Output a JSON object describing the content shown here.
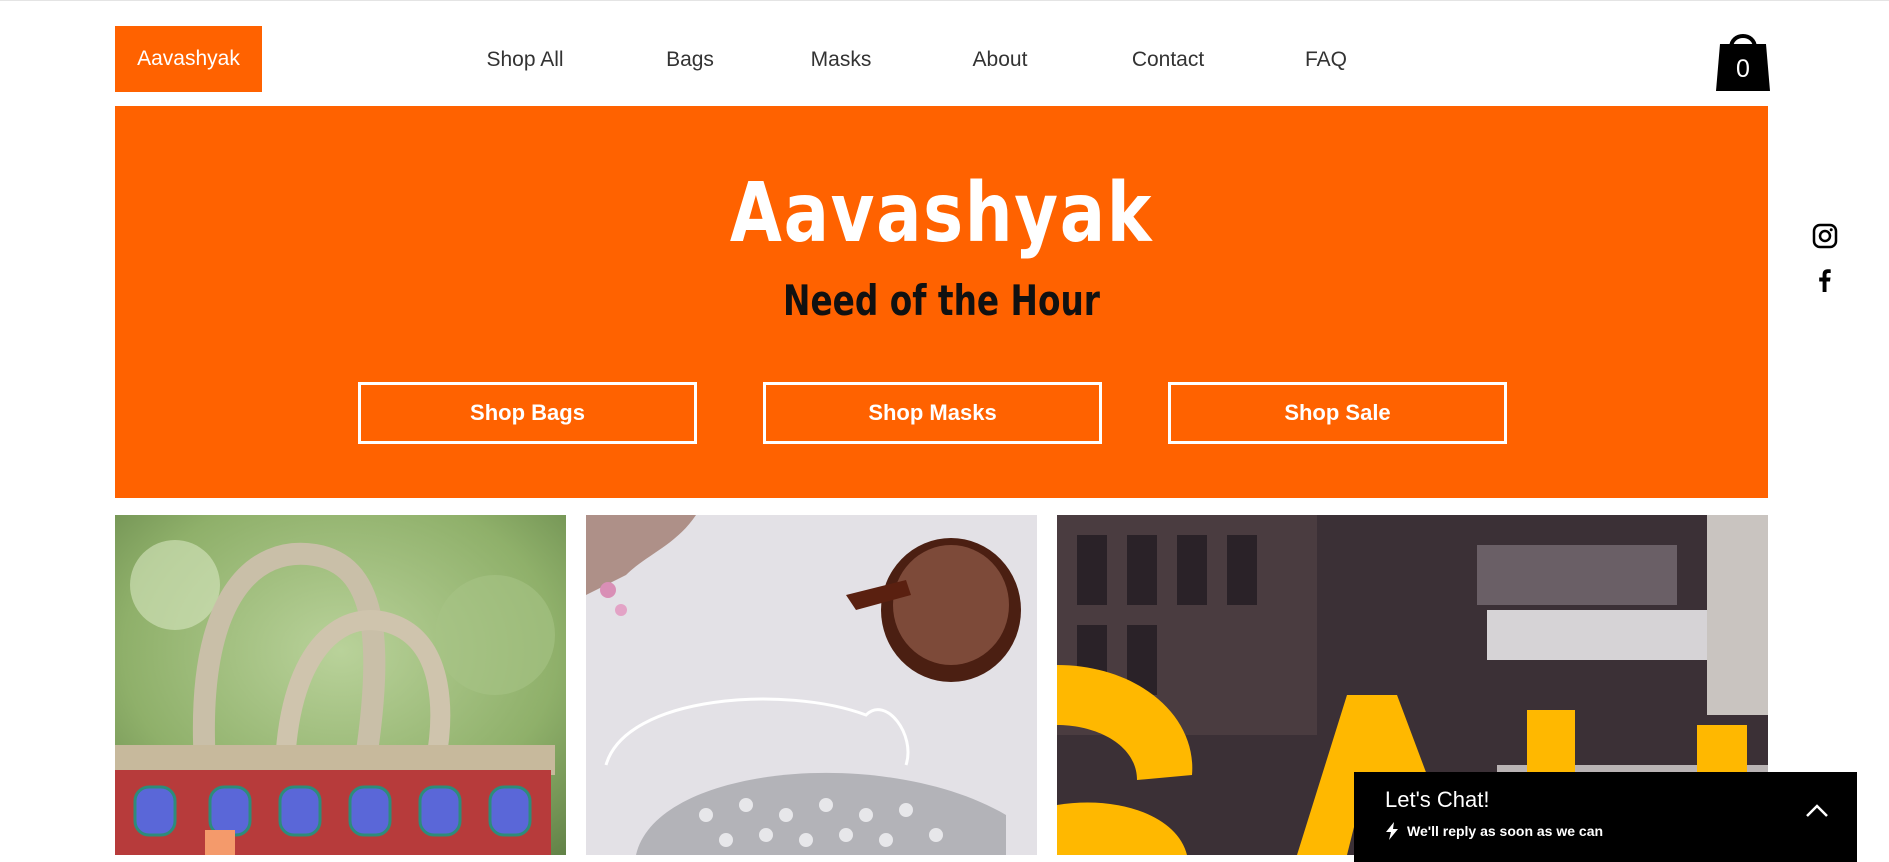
{
  "header": {
    "logo_label": "Aavashyak",
    "nav": [
      {
        "label": "Shop All"
      },
      {
        "label": "Bags"
      },
      {
        "label": "Masks"
      },
      {
        "label": "About"
      },
      {
        "label": "Contact"
      },
      {
        "label": "FAQ"
      }
    ],
    "cart": {
      "icon": "shopping-bag-icon",
      "count": "0"
    }
  },
  "social": [
    {
      "icon": "instagram-icon"
    },
    {
      "icon": "facebook-icon"
    }
  ],
  "hero": {
    "title": "Aavashyak",
    "subtitle": "Need of the Hour",
    "buttons": [
      {
        "label": "Shop Bags"
      },
      {
        "label": "Shop Masks"
      },
      {
        "label": "Shop Sale"
      }
    ]
  },
  "tiles": [
    {
      "subject": "tote bag"
    },
    {
      "subject": "face mask with sunglasses"
    },
    {
      "subject": "sale window sign"
    }
  ],
  "chat": {
    "title": "Let's Chat!",
    "subtitle": "We'll reply as soon as we can",
    "icon": "lightning-icon",
    "toggle_icon": "chevron-up-icon"
  },
  "colors": {
    "brand": "#ff6200",
    "text": "#333333",
    "chat_bg": "#000000"
  }
}
